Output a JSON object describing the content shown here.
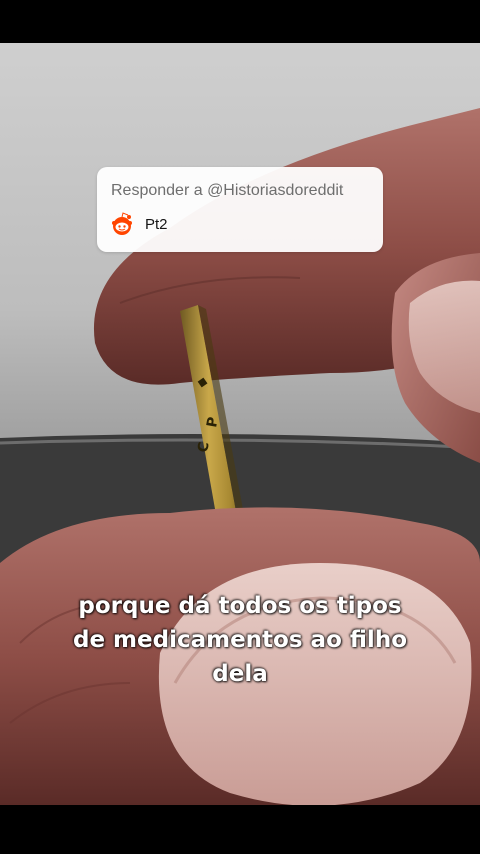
{
  "reply": {
    "title": "Responder a @Historiasdoreddit",
    "text": "Pt2",
    "icon": "reddit-icon"
  },
  "caption": {
    "lines": [
      "porque dá todos os tipos",
      "de medicamentos ao filho",
      "dela"
    ]
  },
  "ring_letters": [
    "C",
    "P"
  ]
}
